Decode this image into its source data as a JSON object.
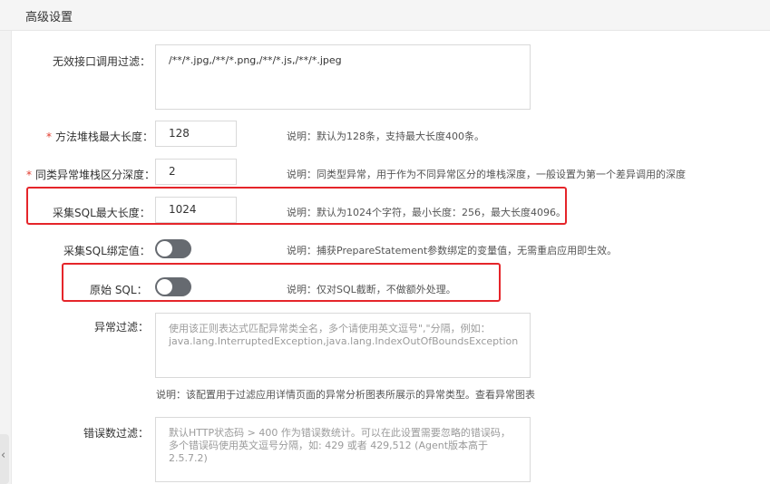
{
  "header": {
    "title": "高级设置"
  },
  "fields": {
    "invalid_api_filter": {
      "label": "无效接口调用过滤：",
      "value": "/**/*.jpg,/**/*.png,/**/*.js,/**/*.jpeg"
    },
    "method_stack_max": {
      "required_mark": "*",
      "label": "方法堆栈最大长度：",
      "value": "128",
      "desc": "说明：默认为128条，支持最大长度400条。"
    },
    "same_exception_stack_depth": {
      "required_mark": "*",
      "label": "同类异常堆栈区分深度：",
      "value": "2",
      "desc": "说明：同类型异常，用于作为不同异常区分的堆栈深度，一般设置为第一个差异调用的深度"
    },
    "sql_max_length": {
      "label": "采集SQL最大长度：",
      "value": "1024",
      "desc": "说明：默认为1024个字符，最小长度：256，最大长度4096。"
    },
    "sql_bind_values": {
      "label": "采集SQL绑定值：",
      "toggle_on": false,
      "desc": "说明：捕获PrepareStatement参数绑定的变量值，无需重启应用即生效。"
    },
    "raw_sql": {
      "label": "原始 SQL：",
      "toggle_on": false,
      "desc": "说明：仅对SQL截断，不做额外处理。"
    },
    "exception_filter": {
      "label": "异常过滤：",
      "placeholder": "使用该正则表达式匹配异常类全名，多个请使用英文逗号\",\"分隔，例如：java.lang.InterruptedException,java.lang.IndexOutOfBoundsException",
      "desc": "说明：该配置用于过滤应用详情页面的异常分析图表所展示的异常类型。查看异常图表"
    },
    "error_code_filter": {
      "label": "错误数过滤：",
      "placeholder": "默认HTTP状态码 > 400 作为错误数统计。可以在此设置需要忽略的错误码，多个错误码使用英文逗号分隔，如: 429 或者 429,512 (Agent版本高于 2.5.7.2)"
    }
  },
  "colors": {
    "highlight": "#e5252a",
    "required": "#e23c2e",
    "toggle_off": "#666a70"
  },
  "icons": {
    "side_tab": "chevron-left-icon"
  }
}
